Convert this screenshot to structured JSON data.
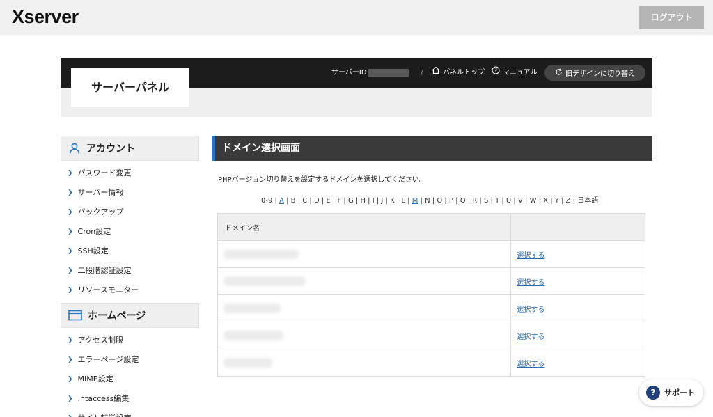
{
  "header": {
    "logo": "Xserver",
    "logout_label": "ログアウト"
  },
  "panel": {
    "title": "サーバーパネル",
    "server_id_label": "サーバーID",
    "separator": "/",
    "panel_top_label": "パネルトップ",
    "manual_label": "マニュアル",
    "old_design_label": "旧デザインに切り替え"
  },
  "sidebar": {
    "sections": [
      {
        "title": "アカウント",
        "icon": "person-icon",
        "items": [
          "パスワード変更",
          "サーバー情報",
          "バックアップ",
          "Cron設定",
          "SSH設定",
          "二段階認証設定",
          "リソースモニター"
        ]
      },
      {
        "title": "ホームページ",
        "icon": "browser-window-icon",
        "items": [
          "アクセス制限",
          "エラーページ設定",
          "MIME設定",
          ".htaccess編集",
          "サイト転送設定"
        ]
      }
    ]
  },
  "main": {
    "title": "ドメイン選択画面",
    "description": "PHPバージョン切り替えを設定するドメインを選択してください。",
    "alpha_nav": [
      {
        "label": "0-9",
        "link": false
      },
      {
        "label": "A",
        "link": true
      },
      {
        "label": "B",
        "link": false
      },
      {
        "label": "C",
        "link": false
      },
      {
        "label": "D",
        "link": false
      },
      {
        "label": "E",
        "link": false
      },
      {
        "label": "F",
        "link": false
      },
      {
        "label": "G",
        "link": false
      },
      {
        "label": "H",
        "link": false
      },
      {
        "label": "I",
        "link": false
      },
      {
        "label": "J",
        "link": false
      },
      {
        "label": "K",
        "link": false
      },
      {
        "label": "L",
        "link": false
      },
      {
        "label": "M",
        "link": true
      },
      {
        "label": "N",
        "link": false
      },
      {
        "label": "O",
        "link": false
      },
      {
        "label": "P",
        "link": false
      },
      {
        "label": "Q",
        "link": false
      },
      {
        "label": "R",
        "link": false
      },
      {
        "label": "S",
        "link": false
      },
      {
        "label": "T",
        "link": false
      },
      {
        "label": "U",
        "link": false
      },
      {
        "label": "V",
        "link": false
      },
      {
        "label": "W",
        "link": false
      },
      {
        "label": "X",
        "link": false
      },
      {
        "label": "Y",
        "link": false
      },
      {
        "label": "Z",
        "link": false
      },
      {
        "label": "日本語",
        "link": false
      }
    ],
    "table": {
      "header": "ドメイン名",
      "select_label": "選択する",
      "rows": 5
    }
  },
  "support": {
    "label": "サポート",
    "icon_glyph": "?"
  },
  "colors": {
    "accent": "#2b74c4",
    "link": "#2a6bb0",
    "header_bar": "#1c1c1c"
  }
}
